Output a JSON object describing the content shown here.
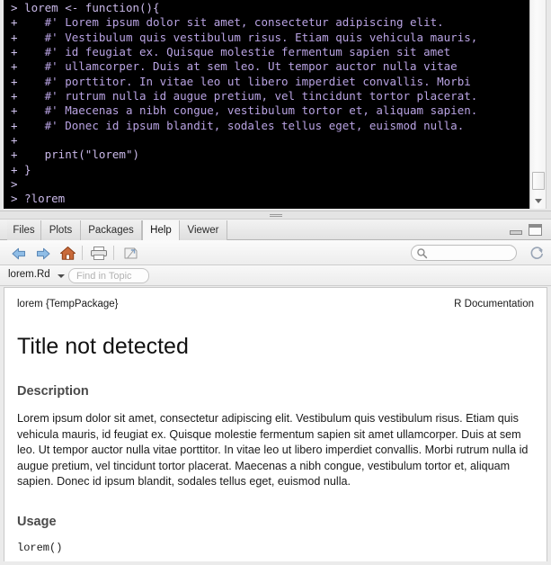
{
  "console": {
    "lines": [
      {
        "prompt": ">",
        "text": " lorem <- function(){"
      },
      {
        "prompt": "+",
        "text": "    #' Lorem ipsum dolor sit amet, consectetur adipiscing elit."
      },
      {
        "prompt": "+",
        "text": "    #' Vestibulum quis vestibulum risus. Etiam quis vehicula mauris,"
      },
      {
        "prompt": "+",
        "text": "    #' id feugiat ex. Quisque molestie fermentum sapien sit amet"
      },
      {
        "prompt": "+",
        "text": "    #' ullamcorper. Duis at sem leo. Ut tempor auctor nulla vitae"
      },
      {
        "prompt": "+",
        "text": "    #' porttitor. In vitae leo ut libero imperdiet convallis. Morbi"
      },
      {
        "prompt": "+",
        "text": "    #' rutrum nulla id augue pretium, vel tincidunt tortor placerat."
      },
      {
        "prompt": "+",
        "text": "    #' Maecenas a nibh congue, vestibulum tortor et, aliquam sapien."
      },
      {
        "prompt": "+",
        "text": "    #' Donec id ipsum blandit, sodales tellus eget, euismod nulla."
      },
      {
        "prompt": "+",
        "text": ""
      },
      {
        "prompt": "+",
        "text": "    print(\"lorem\")"
      },
      {
        "prompt": "+",
        "text": " }"
      },
      {
        "prompt": ">",
        "text": ""
      },
      {
        "prompt": ">",
        "text": " ?lorem"
      },
      {
        "prompt": ">",
        "text": "",
        "cursor": true
      }
    ]
  },
  "help_panel": {
    "tabs": [
      {
        "label": "Files",
        "active": false
      },
      {
        "label": "Plots",
        "active": false
      },
      {
        "label": "Packages",
        "active": false
      },
      {
        "label": "Help",
        "active": true
      },
      {
        "label": "Viewer",
        "active": false
      }
    ],
    "window_controls": {
      "minimize": "minimize-panel-icon",
      "maximize": "maximize-panel-icon"
    },
    "toolbar": {
      "back": "back-arrow-icon",
      "forward": "forward-arrow-icon",
      "home": "home-icon",
      "print": "print-icon",
      "popout": "show-in-new-window-icon",
      "refresh": "refresh-icon",
      "search_placeholder": "",
      "search_value": ""
    },
    "topic_bar": {
      "topic_file": "lorem.Rd",
      "find_placeholder": "Find in Topic",
      "find_value": ""
    }
  },
  "document": {
    "topic_header_left": "lorem {TempPackage}",
    "topic_header_right": "R Documentation",
    "title": "Title not detected",
    "sections": {
      "description_heading": "Description",
      "description_body": "Lorem ipsum dolor sit amet, consectetur adipiscing elit. Vestibulum quis vestibulum risus. Etiam quis vehicula mauris, id feugiat ex. Quisque molestie fermentum sapien sit amet ullamcorper. Duis at sem leo. Ut tempor auctor nulla vitae porttitor. In vitae leo ut libero imperdiet convallis. Morbi rutrum nulla id augue pretium, vel tincidunt tortor placerat. Maecenas a nibh congue, vestibulum tortor et, aliquam sapien. Donec id ipsum blandit, sodales tellus eget, euismod nulla.",
      "usage_heading": "Usage",
      "usage_code": "lorem()"
    }
  },
  "colors": {
    "console_bg": "#000000",
    "console_text": "#c9b8e8",
    "panel_bg": "#ebebeb",
    "doc_bg": "#ffffff",
    "heading_gray": "#4a4a4a"
  }
}
